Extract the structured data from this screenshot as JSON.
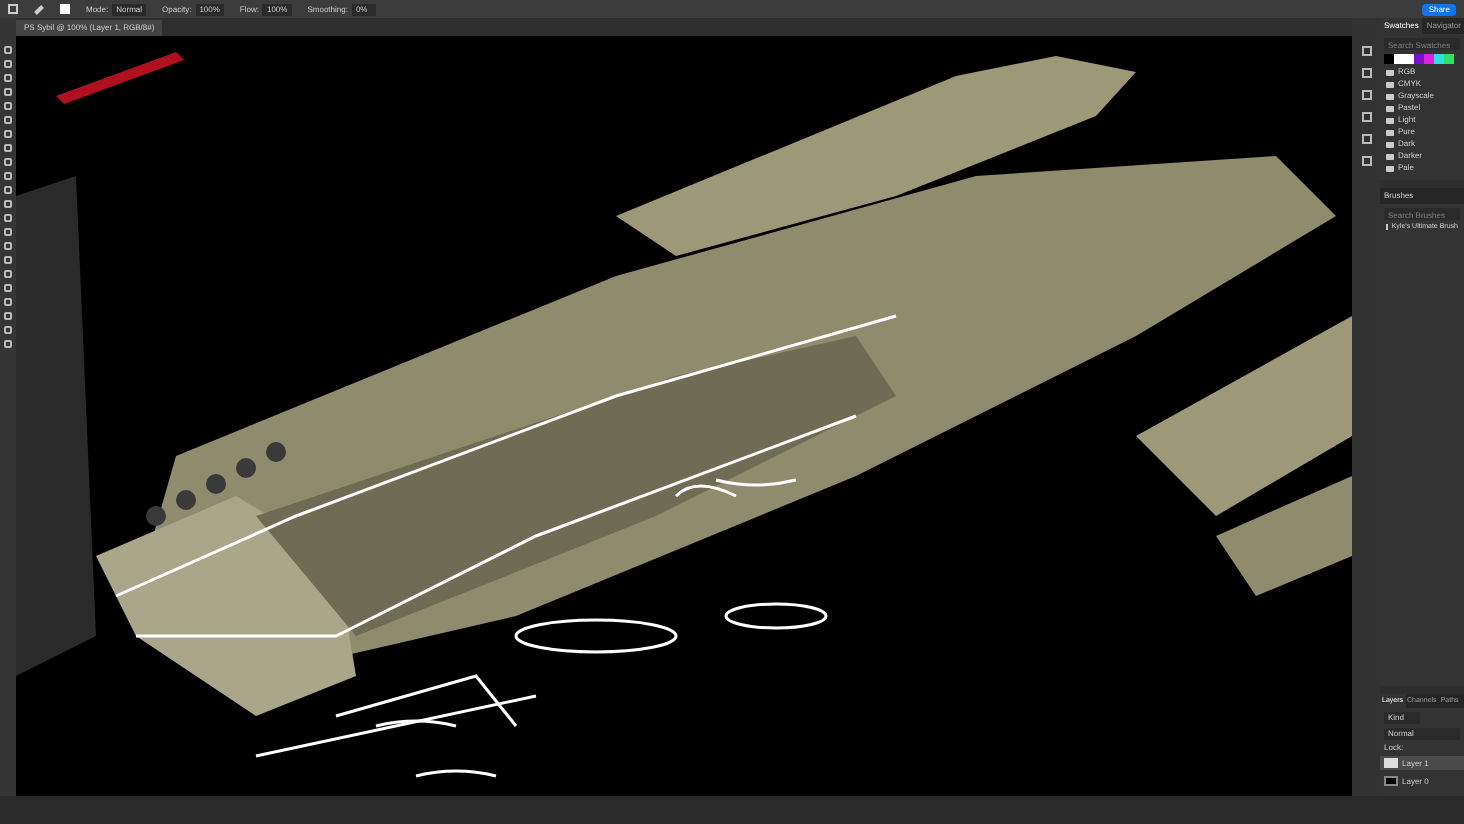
{
  "options_bar": {
    "fields": [
      {
        "label": "Mode:",
        "value": "Normal"
      },
      {
        "label": "Opacity:",
        "value": "100%"
      },
      {
        "label": "Flow:",
        "value": "100%"
      },
      {
        "label": "Smoothing:",
        "value": "0%"
      }
    ],
    "share_button": "Share"
  },
  "document_tab": {
    "title": "PS Sybil @ 100% (Layer 1, RGB/8#)"
  },
  "swatches_panel": {
    "tabs": [
      {
        "label": "Swatches",
        "selected": true
      },
      {
        "label": "Navigator",
        "selected": false
      }
    ],
    "search": {
      "placeholder": "Search Swatches"
    },
    "recent_colors": [
      {
        "color": "#000000"
      },
      {
        "color": "#ffffff"
      },
      {
        "color": "#ffffff"
      },
      {
        "color": "#7a10c8"
      },
      {
        "color": "#e020e0"
      },
      {
        "color": "#30e0e0"
      },
      {
        "color": "#30e060"
      }
    ],
    "folders": [
      "RGB",
      "CMYK",
      "Grayscale",
      "Pastel",
      "Light",
      "Pure",
      "Dark",
      "Darker",
      "Pale"
    ]
  },
  "brushes_panel": {
    "title": "Brushes",
    "search": {
      "placeholder": "Search Brushes"
    },
    "folders": [
      "Kyle's Ultimate Brush"
    ]
  },
  "layers_panel": {
    "tabs": [
      {
        "label": "Layers",
        "selected": true
      },
      {
        "label": "Channels",
        "selected": false
      },
      {
        "label": "Paths",
        "selected": false
      }
    ],
    "filter": "Kind",
    "blend_mode": "Normal",
    "lock_label": "Lock:",
    "layers": [
      {
        "name": "Layer 1",
        "selected": true
      },
      {
        "name": "Layer 0",
        "selected": false
      }
    ]
  }
}
